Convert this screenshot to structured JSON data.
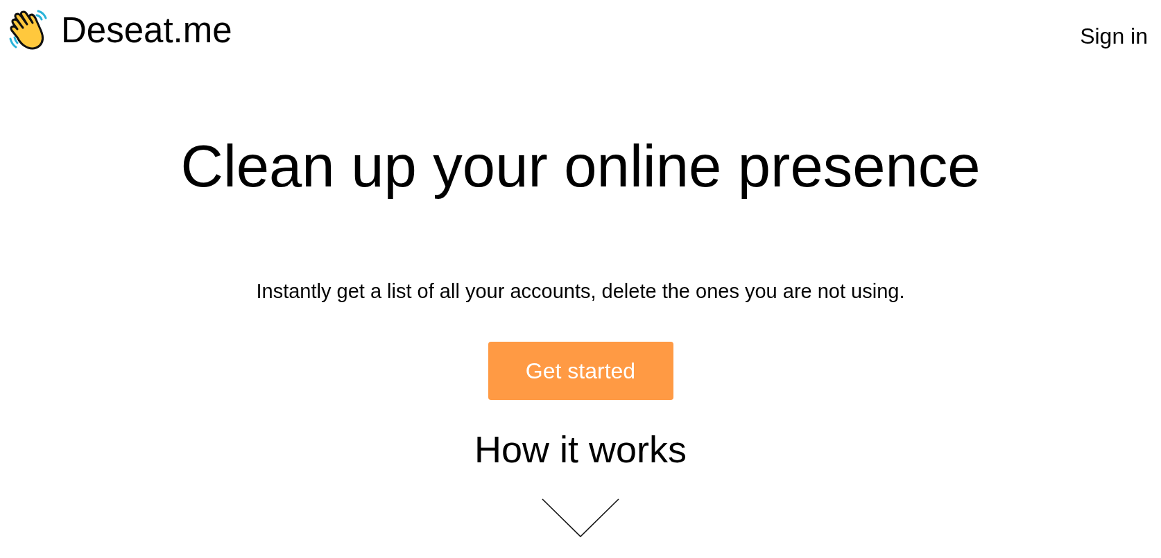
{
  "header": {
    "brand": "Deseat.me",
    "sign_in": "Sign in"
  },
  "hero": {
    "title": "Clean up your online presence",
    "subtitle": "Instantly get a list of all your accounts, delete the ones you are not using.",
    "button": "Get started",
    "section_heading": "How it works"
  }
}
